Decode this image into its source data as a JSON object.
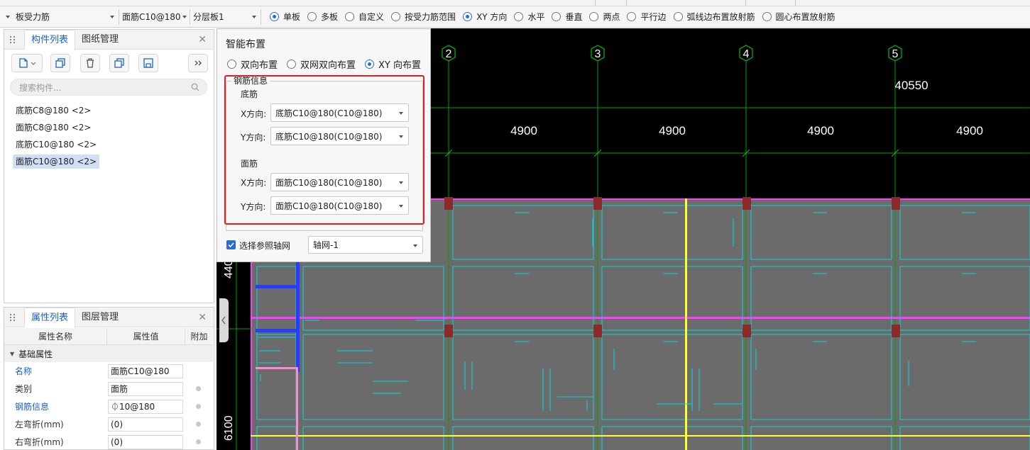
{
  "toolbar": {
    "combo1": "板受力筋",
    "combo2": "面筋C10@180",
    "combo3": "分层板1",
    "radios": [
      {
        "label": "单板",
        "checked": true
      },
      {
        "label": "多板",
        "checked": false
      },
      {
        "label": "自定义",
        "checked": false
      },
      {
        "label": "按受力筋范围",
        "checked": false
      },
      {
        "label": "XY 方向",
        "checked": true
      },
      {
        "label": "水平",
        "checked": false
      },
      {
        "label": "垂直",
        "checked": false
      },
      {
        "label": "两点",
        "checked": false
      },
      {
        "label": "平行边",
        "checked": false
      },
      {
        "label": "弧线边布置放射筋",
        "checked": false
      },
      {
        "label": "圆心布置放射筋",
        "checked": false
      }
    ]
  },
  "component_panel": {
    "tabs": [
      "构件列表",
      "图纸管理"
    ],
    "search_placeholder": "搜索构件...",
    "items": [
      {
        "label": "底筋C8@180 <2>",
        "selected": false
      },
      {
        "label": "面筋C8@180 <2>",
        "selected": false
      },
      {
        "label": "底筋C10@180 <2>",
        "selected": false
      },
      {
        "label": "面筋C10@180 <2>",
        "selected": true
      }
    ]
  },
  "property_panel": {
    "tabs": [
      "属性列表",
      "图层管理"
    ],
    "headers": [
      "属性名称",
      "属性值",
      "附加"
    ],
    "group": "基础属性",
    "rows": [
      {
        "name": "名称",
        "value": "面筋C10@180",
        "blue": true,
        "dot": false
      },
      {
        "name": "类别",
        "value": "面筋",
        "blue": false,
        "dot": true
      },
      {
        "name": "钢筋信息",
        "value": "⏀10@180",
        "blue": true,
        "dot": true
      },
      {
        "name": "左弯折(mm)",
        "value": "(0)",
        "blue": false,
        "dot": true
      },
      {
        "name": "右弯折(mm)",
        "value": "(0)",
        "blue": false,
        "dot": true
      }
    ]
  },
  "dialog": {
    "title": "智能布置",
    "modes": [
      {
        "label": "双向布置",
        "checked": false
      },
      {
        "label": "双网双向布置",
        "checked": false
      },
      {
        "label": "XY 向布置",
        "checked": true
      }
    ],
    "group_label": "钢筋信息",
    "bottom_label": "底筋",
    "top_label": "面筋",
    "x_label": "X方向:",
    "y_label": "Y方向:",
    "bottom_x": "底筋C10@180(C10@180)",
    "bottom_y": "底筋C10@180(C10@180)",
    "top_x": "面筋C10@180(C10@180)",
    "top_y": "面筋C10@180(C10@180)",
    "axis_checkbox": "选择参照轴网",
    "axis_value": "轴网-1"
  },
  "cad": {
    "axis_numbers": [
      "2",
      "3",
      "4",
      "5"
    ],
    "total_dim": "40550",
    "spans": [
      "4900",
      "4900",
      "4900",
      "4900"
    ],
    "side_dims": [
      "440",
      "6100"
    ],
    "colors": {
      "background": "#000000",
      "slab": "#6b6b6b",
      "grid": "#00e0e0",
      "magenta": "#ff3cff",
      "yellow": "#ffff30",
      "dim_line": "#00c000",
      "beam_blue": "#2a3cff"
    }
  }
}
